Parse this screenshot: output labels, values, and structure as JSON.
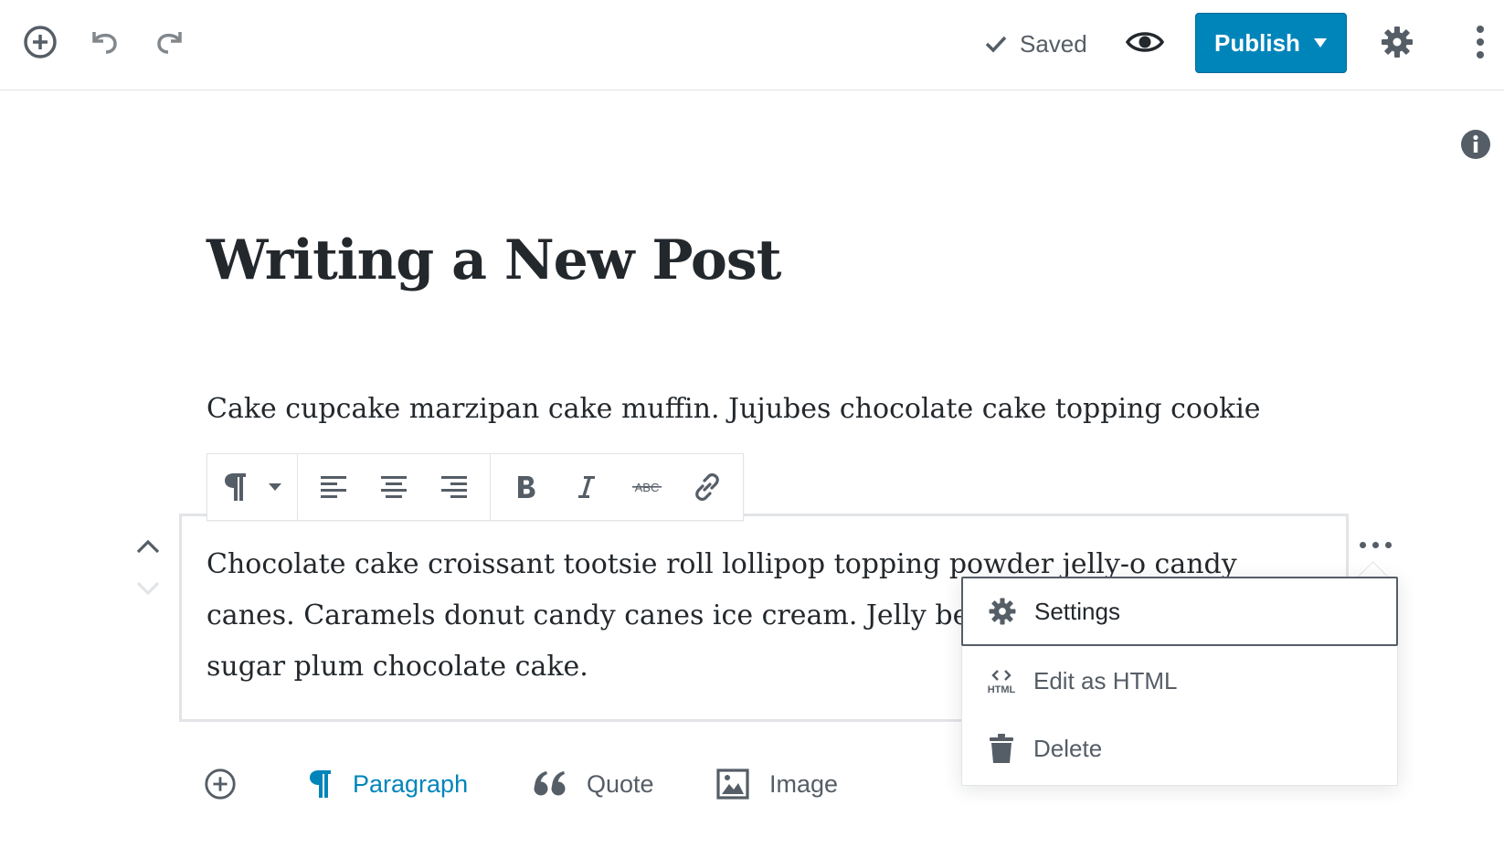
{
  "topbar": {
    "add_block_icon": "plus-circle-icon",
    "undo_icon": "undo-icon",
    "redo_icon": "redo-icon",
    "saved_label": "Saved",
    "preview_icon": "eye-icon",
    "publish_label": "Publish",
    "settings_icon": "gear-icon",
    "more_icon": "vertical-ellipsis-icon"
  },
  "post": {
    "title": "Writing a New Post",
    "paragraph1": "Cake cupcake marzipan cake muffin. Jujubes chocolate cake topping cookie muffin. Lollipop tart sugar plum.",
    "selected_block_text": "Chocolate cake croissant tootsie roll lollipop topping powder jelly-o candy canes. Caramels donut candy canes ice cream. Jelly beans caramels tart sugar plum chocolate cake."
  },
  "block_toolbar": {
    "items": [
      "paragraph-icon",
      "dropdown-arrow-icon",
      "align-left-icon",
      "align-center-icon",
      "align-right-icon",
      "bold-icon",
      "italic-icon",
      "strikethrough-icon",
      "link-icon"
    ],
    "strikethrough_text": "ABC"
  },
  "block_menu": {
    "settings": "Settings",
    "edit_html": "Edit as HTML",
    "html_icon_text": "HTML",
    "delete": "Delete"
  },
  "inserter": {
    "paragraph": "Paragraph",
    "quote": "Quote",
    "image": "Image"
  },
  "colors": {
    "accent": "#0085ba",
    "text": "#23282d",
    "muted": "#555d66",
    "border": "#e2e4e7"
  }
}
